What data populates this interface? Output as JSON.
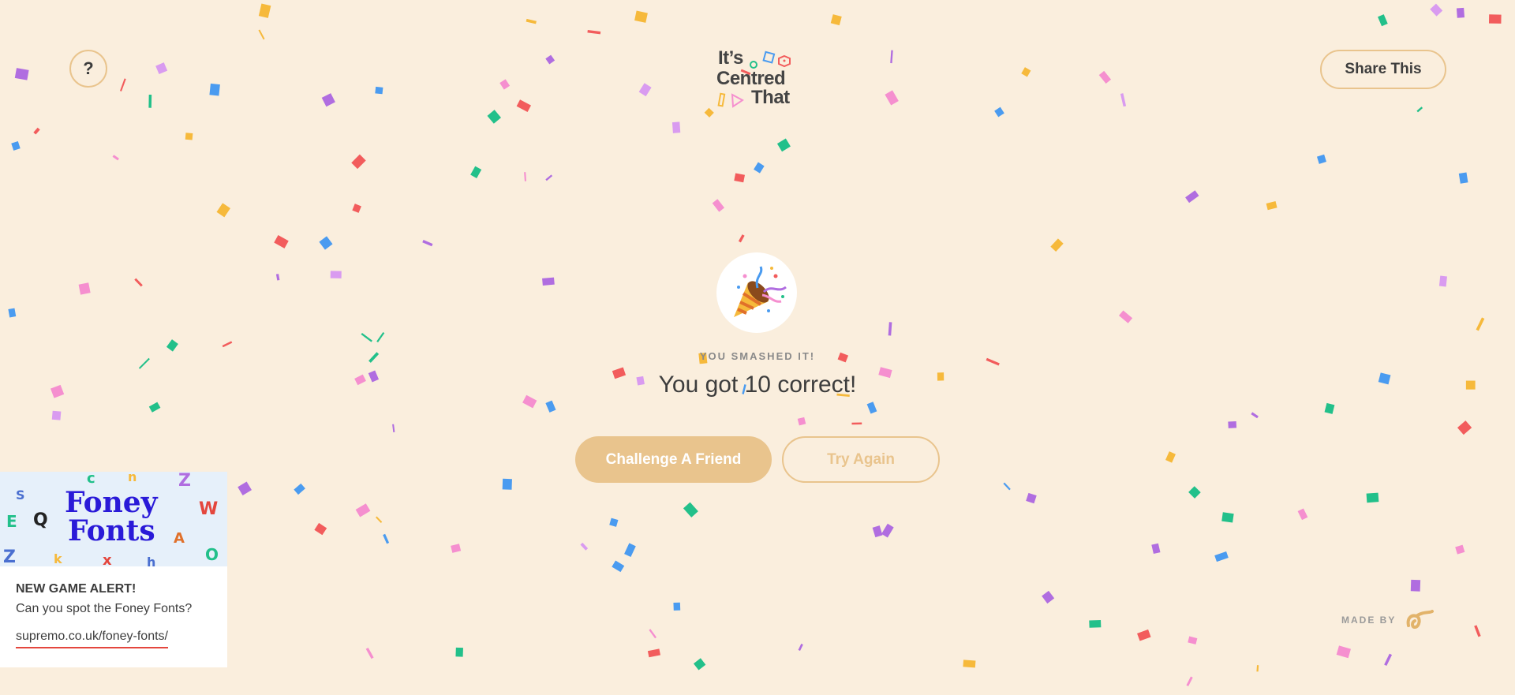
{
  "header": {
    "help_label": "?",
    "share_label": "Share This",
    "logo_lines": [
      "It’s",
      "Centred",
      "That"
    ]
  },
  "result": {
    "eyebrow": "YOU SMASHED IT!",
    "score_text": "You got 10 correct!",
    "emoji_icon": "party-popper-icon"
  },
  "actions": {
    "challenge_label": "Challenge A Friend",
    "try_again_label": "Try Again"
  },
  "promo": {
    "banner_title_line1": "Foney",
    "banner_title_line2": "Fonts",
    "title": "NEW GAME ALERT!",
    "text": "Can you spot the Foney Fonts?",
    "link": "supremo.co.uk/foney-fonts/"
  },
  "footer": {
    "made_by_label": "MADE BY",
    "made_by_icon": "supremo-logo-icon"
  },
  "colors": {
    "background": "#faeedd",
    "accent": "#e9c48d",
    "text": "#3d3d3d",
    "link_underline": "#e4463d",
    "confetti": [
      "#f25c5c",
      "#b06de0",
      "#f58fcf",
      "#4a9bf0",
      "#22c08a",
      "#f6b93b",
      "#d99bf0"
    ]
  }
}
